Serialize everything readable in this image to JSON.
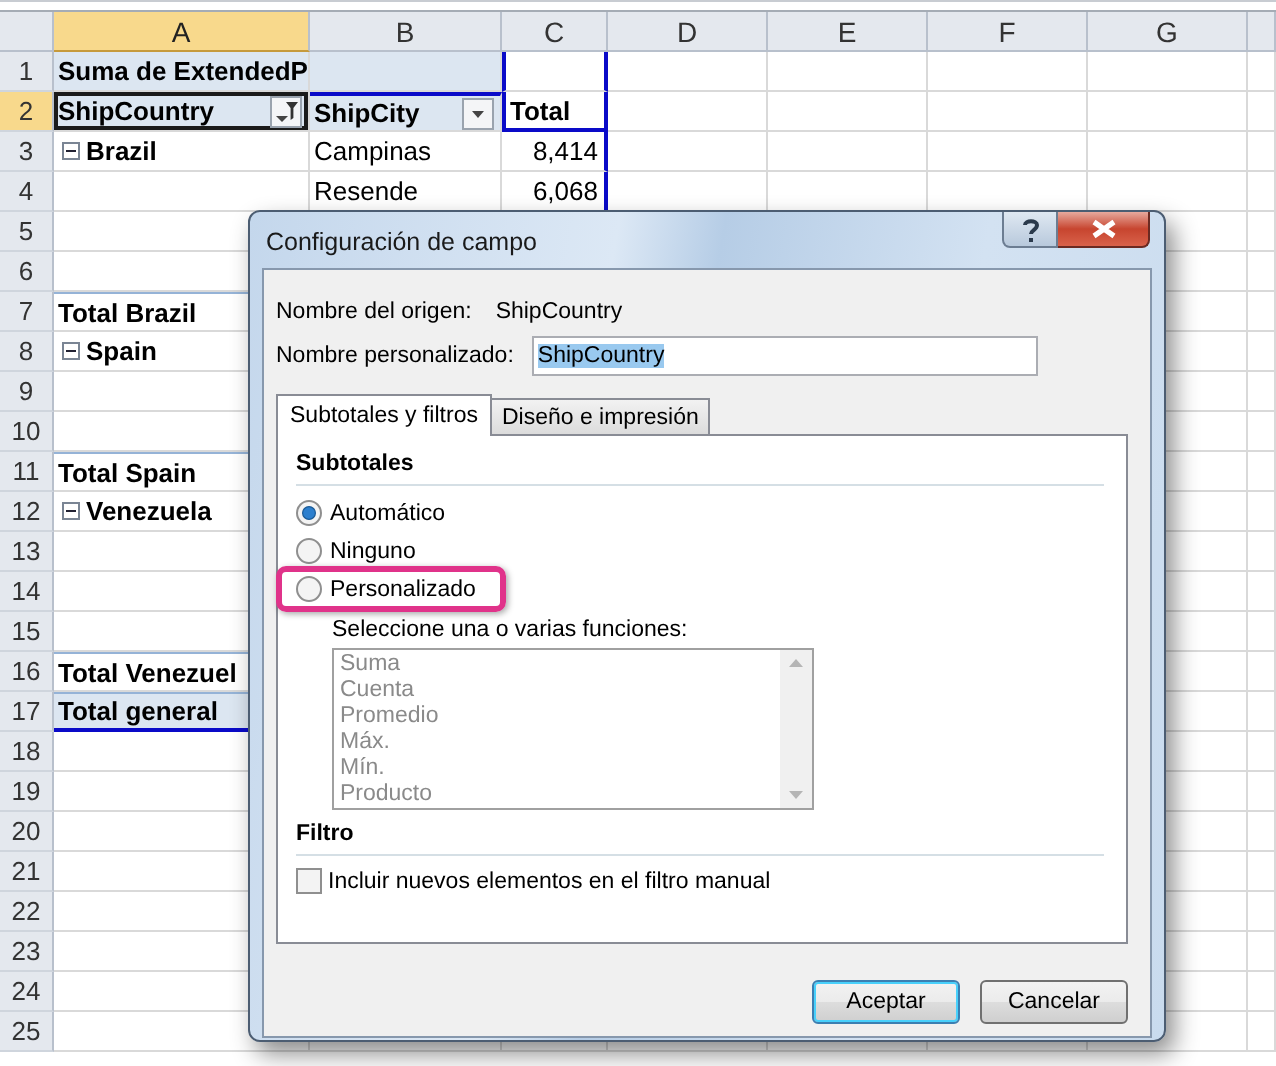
{
  "sheet": {
    "columns": [
      {
        "label": "A",
        "selected": true
      },
      {
        "label": "B",
        "selected": false
      },
      {
        "label": "C",
        "selected": false
      },
      {
        "label": "D",
        "selected": false
      },
      {
        "label": "E",
        "selected": false
      },
      {
        "label": "F",
        "selected": false
      },
      {
        "label": "G",
        "selected": false
      }
    ],
    "rows": [
      {
        "number": "1",
        "selected": false,
        "kind": "title",
        "a": "Suma de ExtendedP"
      },
      {
        "number": "2",
        "selected": true,
        "kind": "header",
        "a": "ShipCountry",
        "b": "ShipCity",
        "c": "Total",
        "filters": [
          {
            "filtered": true
          },
          {
            "filtered": false
          }
        ]
      },
      {
        "number": "3",
        "selected": false,
        "kind": "country",
        "expanded": true,
        "a": "Brazil",
        "b": "Campinas",
        "c": "8,414"
      },
      {
        "number": "4",
        "selected": false,
        "kind": "item",
        "b": "Resende",
        "c": "6,068"
      },
      {
        "number": "5",
        "selected": false,
        "kind": "item"
      },
      {
        "number": "6",
        "selected": false,
        "kind": "item"
      },
      {
        "number": "7",
        "selected": false,
        "kind": "total",
        "a": "Total Brazil"
      },
      {
        "number": "8",
        "selected": false,
        "kind": "country",
        "expanded": true,
        "a": "Spain"
      },
      {
        "number": "9",
        "selected": false,
        "kind": "item"
      },
      {
        "number": "10",
        "selected": false,
        "kind": "item"
      },
      {
        "number": "11",
        "selected": false,
        "kind": "total",
        "a": "Total Spain"
      },
      {
        "number": "12",
        "selected": false,
        "kind": "country",
        "expanded": true,
        "a": "Venezuela"
      },
      {
        "number": "13",
        "selected": false,
        "kind": "item"
      },
      {
        "number": "14",
        "selected": false,
        "kind": "item"
      },
      {
        "number": "15",
        "selected": false,
        "kind": "item"
      },
      {
        "number": "16",
        "selected": false,
        "kind": "total",
        "a": "Total Venezuel"
      },
      {
        "number": "17",
        "selected": false,
        "kind": "grand",
        "a": "Total general"
      },
      {
        "number": "18",
        "selected": false,
        "kind": "empty"
      },
      {
        "number": "19",
        "selected": false,
        "kind": "empty"
      },
      {
        "number": "20",
        "selected": false,
        "kind": "empty"
      },
      {
        "number": "21",
        "selected": false,
        "kind": "empty"
      },
      {
        "number": "22",
        "selected": false,
        "kind": "empty"
      },
      {
        "number": "23",
        "selected": false,
        "kind": "empty"
      },
      {
        "number": "24",
        "selected": false,
        "kind": "empty"
      },
      {
        "number": "25",
        "selected": false,
        "kind": "empty"
      }
    ]
  },
  "dialog": {
    "title": "Configuración de campo",
    "source_label": "Nombre del origen:",
    "source_value": "ShipCountry",
    "custom_name_label": "Nombre personalizado:",
    "custom_name_value": "ShipCountry",
    "custom_name_text_selected": true,
    "tabs": [
      {
        "label": "Subtotales y filtros",
        "selected": true
      },
      {
        "label": "Diseño e impresión",
        "selected": false
      }
    ],
    "subtotals": {
      "heading": "Subtotales",
      "options": [
        {
          "label": "Automático",
          "selected": true,
          "highlighted": false
        },
        {
          "label": "Ninguno",
          "selected": false,
          "highlighted": false
        },
        {
          "label": "Personalizado",
          "selected": false,
          "highlighted": true
        }
      ],
      "functions_label": "Seleccione una o varias funciones:",
      "functions": {
        "disabled": true,
        "items": [
          "Suma",
          "Cuenta",
          "Promedio",
          "Máx.",
          "Mín.",
          "Producto"
        ]
      }
    },
    "filter": {
      "heading": "Filtro",
      "checkbox": {
        "label": "Incluir nuevos elementos en el filtro manual",
        "checked": false
      }
    },
    "buttons": [
      {
        "label": "Aceptar",
        "default": true
      },
      {
        "label": "Cancelar",
        "default": false
      }
    ]
  }
}
